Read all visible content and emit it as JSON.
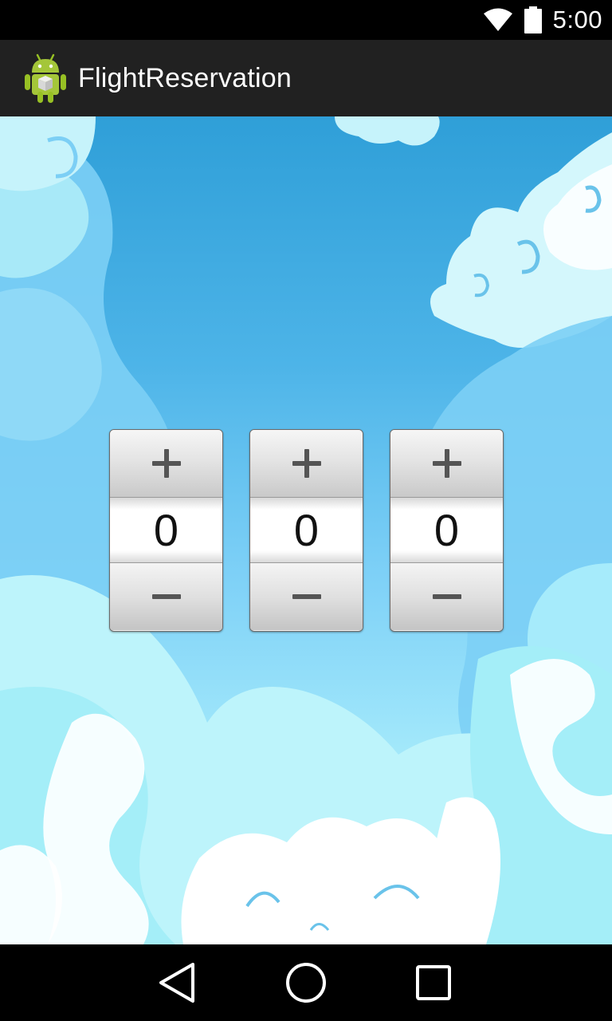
{
  "status_bar": {
    "time": "5:00",
    "icons": [
      "wifi-icon",
      "battery-icon"
    ]
  },
  "action_bar": {
    "title": "FlightReservation",
    "icon": "android-app-icon"
  },
  "pickers": [
    {
      "increment_label": "+",
      "value": "0",
      "decrement_label": "−"
    },
    {
      "increment_label": "+",
      "value": "0",
      "decrement_label": "−"
    },
    {
      "increment_label": "+",
      "value": "0",
      "decrement_label": "−"
    }
  ],
  "nav_bar": {
    "icons": [
      "back-icon",
      "home-icon",
      "recents-icon"
    ]
  },
  "colors": {
    "status_bar": "#000000",
    "action_bar": "#212121",
    "sky_top": "#2f9fd8",
    "sky_bottom": "#c8f6fc"
  }
}
